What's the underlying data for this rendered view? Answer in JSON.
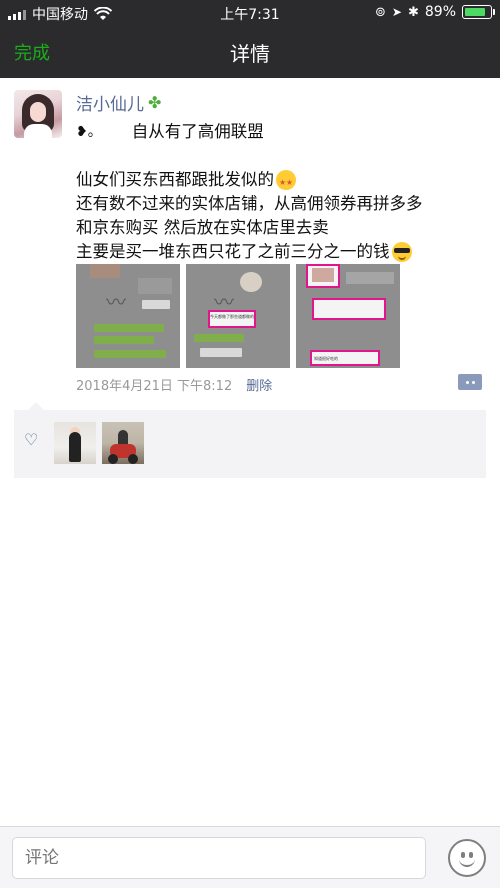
{
  "status_bar": {
    "carrier": "中国移动",
    "time": "上午7:31",
    "battery_percent": "89%",
    "battery_level": 0.89
  },
  "nav": {
    "done_label": "完成",
    "title": "详情"
  },
  "post": {
    "username": "洁小仙儿",
    "first_line": "自从有了高佣联盟",
    "lines": [
      "仙女们买东西都跟批发似的",
      "还有数不过来的实体店铺，从高佣领券再拼多多",
      "和京东购买 然后放在实体店里去卖",
      "主要是买一堆东西只花了之前三分之一的钱"
    ],
    "photo_count": 3,
    "photo_texts": [
      "",
      "今天都做了那些道都做的",
      "知道很好吃的"
    ],
    "timestamp": "2018年4月21日 下午8:12",
    "delete_label": "删除"
  },
  "icons": {
    "clover": "four-leaf-clover-icon",
    "heart": "heart-outline-icon",
    "comment": "comment-icon",
    "emoji": "smiley-face-icon"
  },
  "comment_bar": {
    "placeholder": "评论"
  },
  "colors": {
    "accent_green": "#1aad19",
    "link_blue": "#576b95",
    "nav_bg": "#2b2b2d"
  }
}
